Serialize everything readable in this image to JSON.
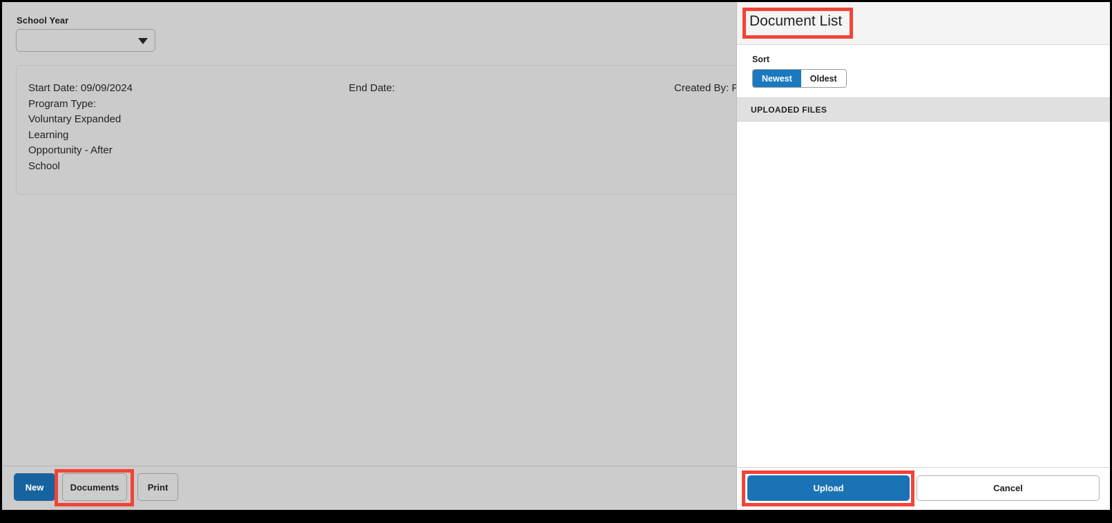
{
  "main": {
    "school_year": {
      "label": "School Year",
      "value": "",
      "caret_icon": "chevron-down-icon"
    },
    "detail": {
      "col1": [
        "Start Date: 09/09/2024",
        "Program Type:",
        "Voluntary Expanded",
        "Learning",
        "Opportunity - After",
        "School"
      ],
      "col2": [
        "End Date:"
      ],
      "col3": [
        "Created By: P"
      ]
    },
    "actions": {
      "new_label": "New",
      "documents_label": "Documents",
      "print_label": "Print"
    }
  },
  "document_panel": {
    "title": "Document List",
    "sort": {
      "label": "Sort",
      "options": [
        "Newest",
        "Oldest"
      ],
      "selected": "Newest"
    },
    "uploaded_files": {
      "header": "UPLOADED FILES",
      "items": []
    },
    "footer": {
      "upload_label": "Upload",
      "cancel_label": "Cancel"
    }
  },
  "colors": {
    "accent_blue": "#1a73b5",
    "primary_button_blue": "#17639f",
    "annotation_red": "#f44336",
    "panel_background": "#cccccc",
    "header_background": "#f4f4f4",
    "section_band": "#e0e0e0"
  }
}
